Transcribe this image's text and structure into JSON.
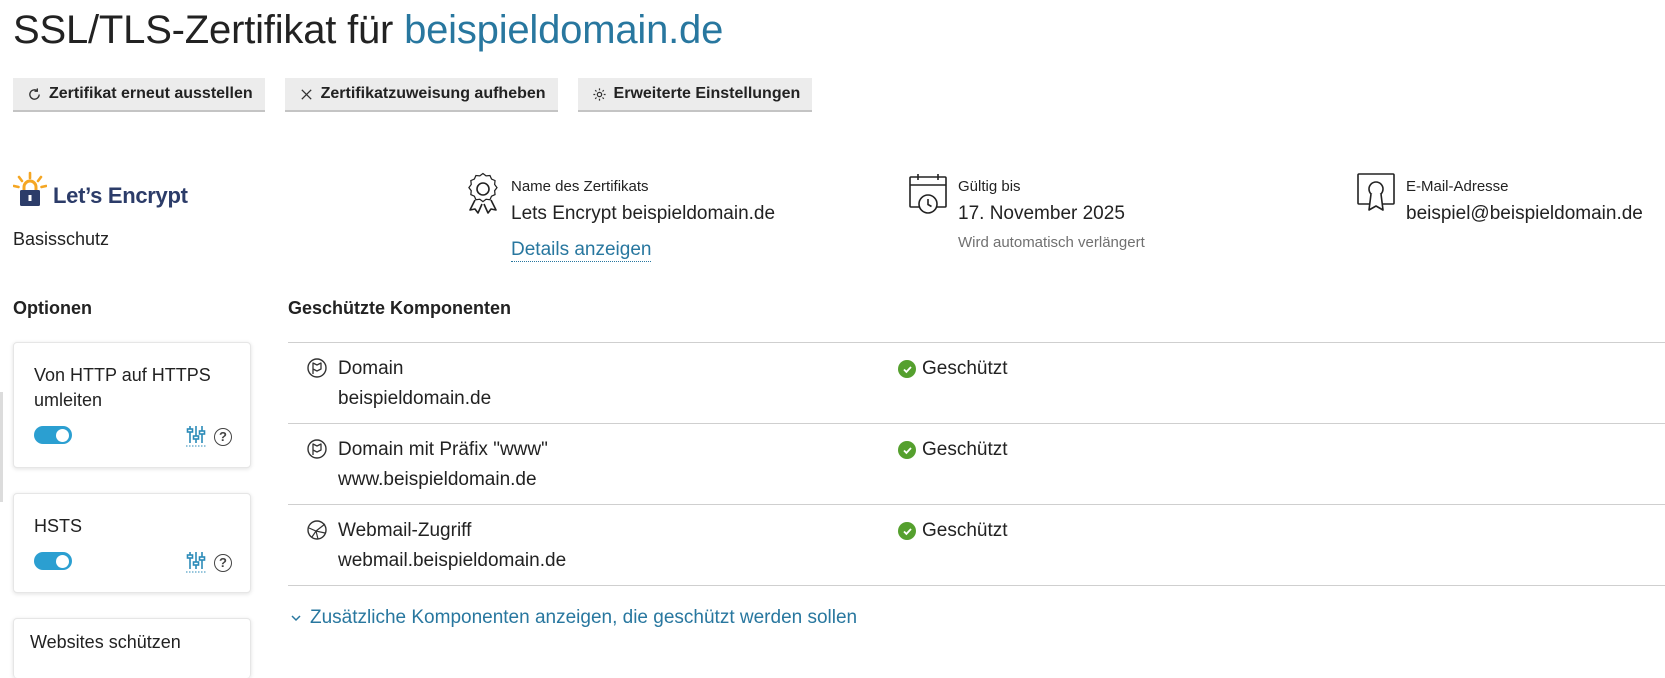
{
  "header": {
    "title_prefix": "SSL/TLS-Zertifikat für",
    "title_domain": "beispieldomain.de"
  },
  "toolbar": {
    "reissue_label": "Zertifikat erneut ausstellen",
    "unassign_label": "Zertifikatzuweisung aufheben",
    "advanced_label": "Erweiterte Einstellungen"
  },
  "provider": {
    "name": "Let’s Encrypt",
    "level": "Basisschutz",
    "accent": "#f5a623",
    "brand_color": "#2c3c69"
  },
  "certificate": {
    "name_label": "Name des Zertifikats",
    "name_value": "Lets Encrypt beispieldomain.de",
    "details_link": "Details anzeigen",
    "valid_label": "Gültig bis",
    "valid_value": "17. November 2025",
    "valid_note": "Wird automatisch verlängert",
    "email_label": "E-Mail-Adresse",
    "email_value": "beispiel@beispieldomain.de"
  },
  "options": {
    "heading": "Optionen",
    "items": [
      {
        "label": "Von HTTP auf HTTPS umleiten",
        "enabled": true,
        "icons": [
          "sliders-icon",
          "help-icon"
        ]
      },
      {
        "label": "HSTS",
        "enabled": true,
        "icons": [
          "sliders-icon",
          "help-icon"
        ]
      },
      {
        "label": "Websites schützen"
      }
    ],
    "help_glyph": "?"
  },
  "components": {
    "heading": "Geschützte Komponenten",
    "rows": [
      {
        "icon": "domain-icon",
        "name": "Domain",
        "domain": "beispieldomain.de",
        "status": "Geschützt"
      },
      {
        "icon": "domain-icon",
        "name": "Domain mit Präfix \"www\"",
        "domain": "www.beispieldomain.de",
        "status": "Geschützt"
      },
      {
        "icon": "webmail-icon",
        "name": "Webmail-Zugriff",
        "domain": "webmail.beispieldomain.de",
        "status": "Geschützt"
      }
    ],
    "status_color": "#55a02e",
    "show_more": "Zusätzliche Komponenten anzeigen, die geschützt werden sollen"
  },
  "colors": {
    "link": "#28779f",
    "toggle_on": "#2b9fd1"
  }
}
